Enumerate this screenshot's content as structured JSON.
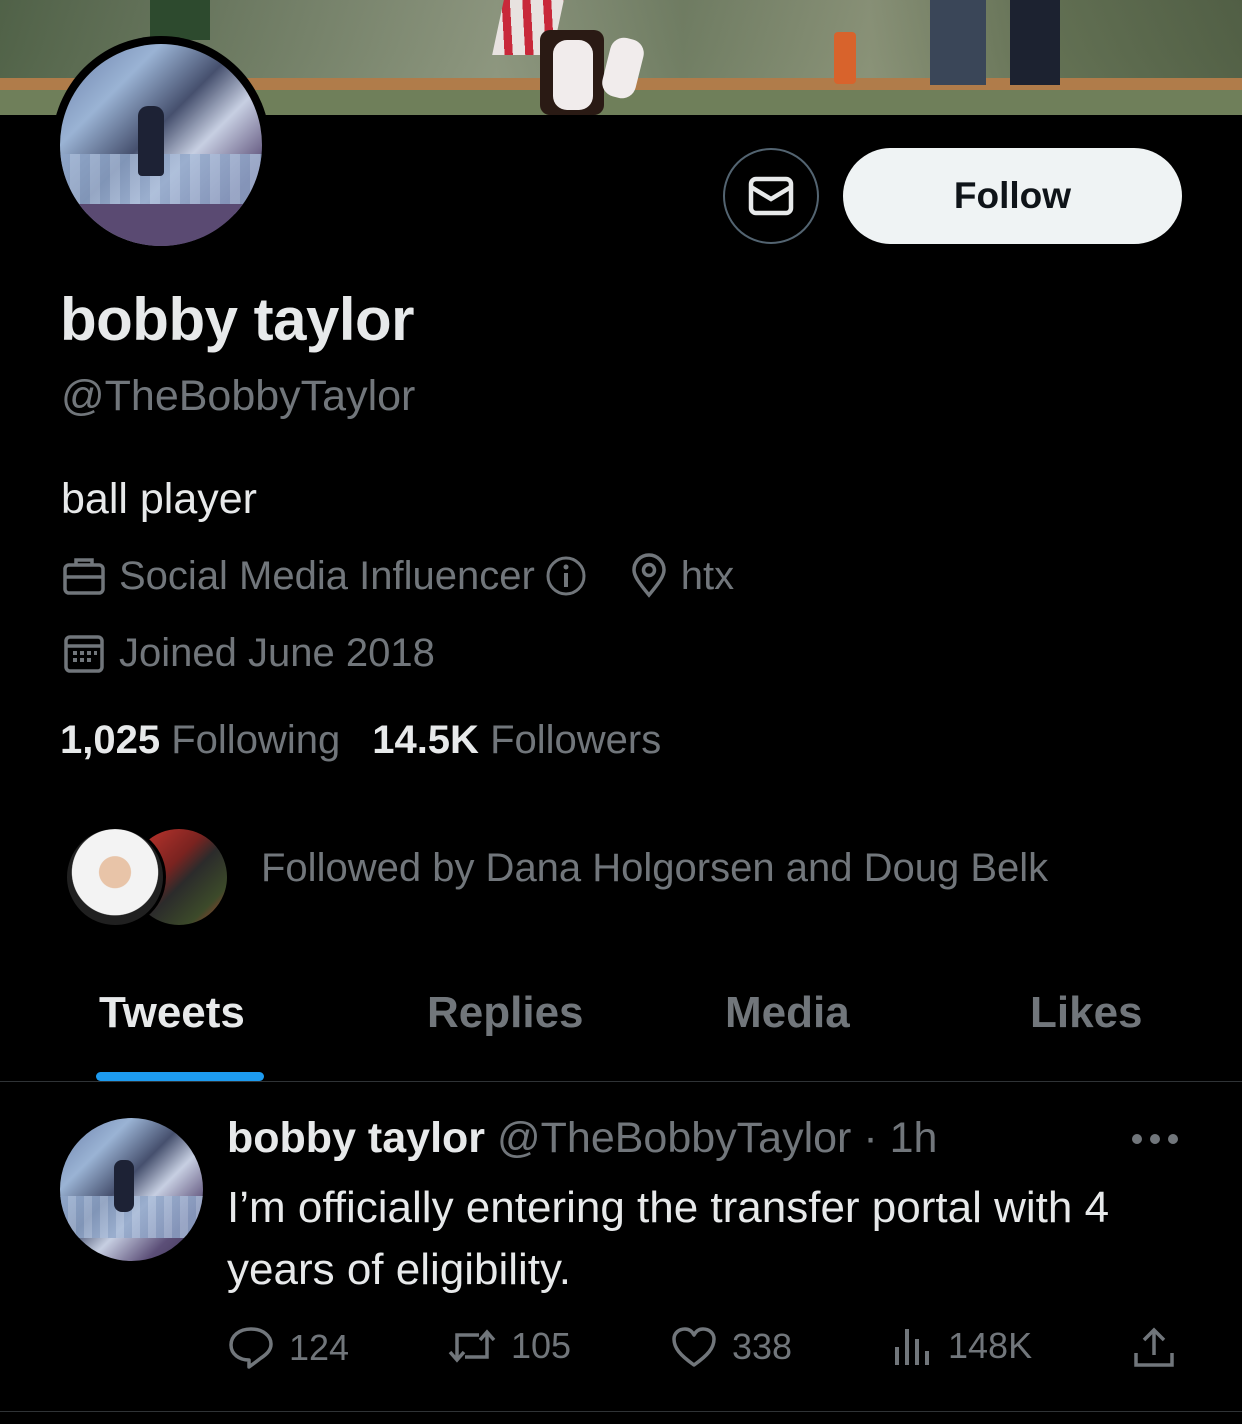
{
  "profile": {
    "name": "bobby taylor",
    "handle": "@TheBobbyTaylor",
    "bio": "ball player",
    "category": "Social Media Influencer",
    "location": "htx",
    "joined": "Joined June 2018",
    "following_count": "1,025",
    "following_label": "Following",
    "followers_count": "14.5K",
    "followers_label": "Followers",
    "followed_by": "Followed by Dana Holgorsen and Doug Belk"
  },
  "actions": {
    "message_icon": "envelope-icon",
    "follow_label": "Follow"
  },
  "tabs": [
    {
      "label": "Tweets",
      "active": true
    },
    {
      "label": "Replies",
      "active": false
    },
    {
      "label": "Media",
      "active": false
    },
    {
      "label": "Likes",
      "active": false
    }
  ],
  "tweet": {
    "author_name": "bobby taylor",
    "author_handle": "@TheBobbyTaylor",
    "time": "· 1h",
    "text": "I’m officially entering the transfer portal with 4 years of eligibility.",
    "replies": "124",
    "retweets": "105",
    "likes": "338",
    "views": "148K"
  },
  "colors": {
    "background": "#000000",
    "primary_text": "#e7e9ea",
    "secondary_text": "#71767b",
    "accent": "#1d9bf0",
    "follow_button_bg": "#eff3f4"
  }
}
